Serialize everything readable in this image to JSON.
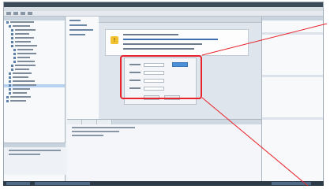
{
  "colors": {
    "highlight": "#e8232b",
    "accent": "#4a90d9",
    "warning": "#f2c230",
    "statusbar": "#2d3a47"
  },
  "icons": {
    "warning": "warning-icon"
  },
  "infobox": {
    "icon_glyph": "!"
  }
}
